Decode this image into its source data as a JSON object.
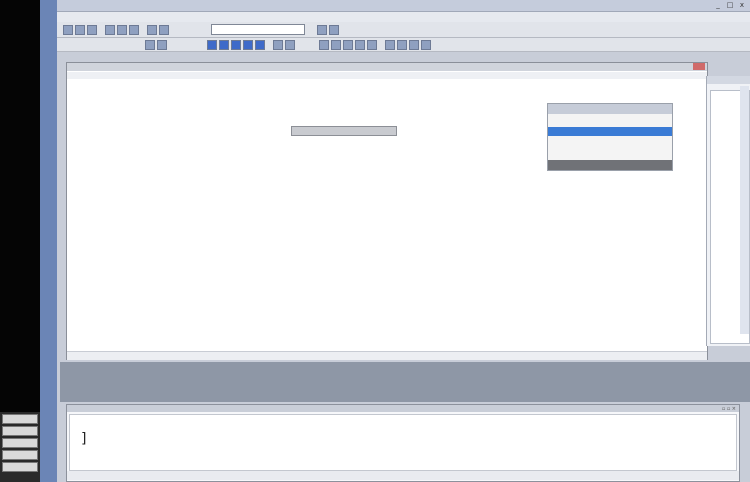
{
  "window": {
    "title": "",
    "controls": [
      "_",
      "□",
      "x"
    ]
  },
  "menu": {
    "items": [
      "",
      "",
      "",
      "",
      "",
      "",
      "",
      "",
      ""
    ]
  },
  "toolbar": {
    "combo_value": ""
  },
  "editor": {
    "title": "",
    "tab_label": "",
    "lines": [
      {
        "text": "",
        "kind": "code"
      },
      {
        "text": "",
        "kind": "string"
      },
      {
        "text": "",
        "kind": "code"
      },
      {
        "text": "",
        "kind": "code"
      },
      {
        "text": "",
        "kind": "code"
      },
      {
        "text": "",
        "kind": "code"
      },
      {
        "text": "",
        "kind": "code"
      },
      {
        "text": "",
        "kind": "code"
      },
      {
        "text": "",
        "kind": "string"
      },
      {
        "text": "",
        "kind": "code"
      },
      {
        "text": "",
        "kind": "code"
      },
      {
        "text": "",
        "kind": "code"
      },
      {
        "text": "",
        "kind": "code"
      },
      {
        "text": "",
        "kind": "code"
      },
      {
        "text": "",
        "kind": "code"
      }
    ],
    "tooltip": "",
    "autocomplete": {
      "items": [
        "",
        "",
        ""
      ]
    }
  },
  "output": {
    "title": "",
    "content": "]",
    "buttons": "▫ ▫ ×"
  },
  "colors": {
    "accent": "#3a7bd5",
    "string": "#d02cd0",
    "keyword": "#1c2f8a",
    "left_rail": "#6b85b6"
  }
}
